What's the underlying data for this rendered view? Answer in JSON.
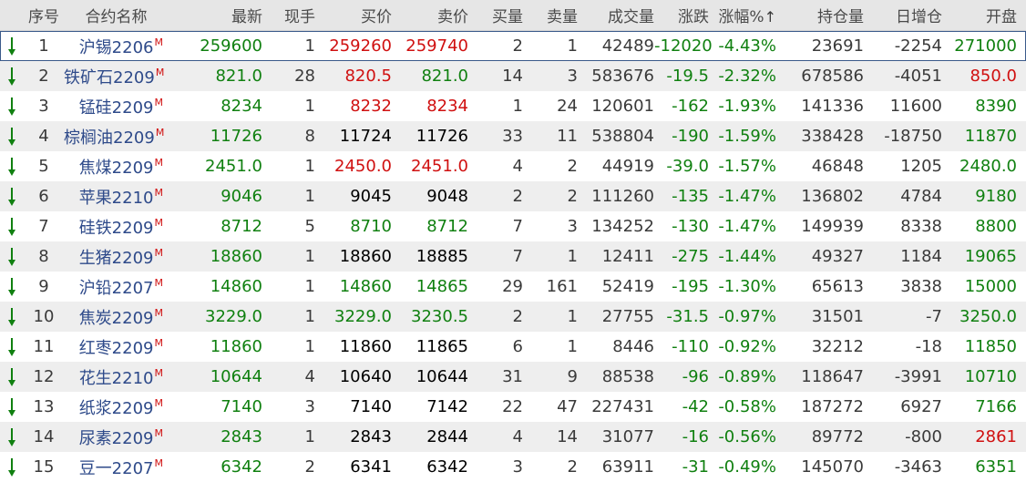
{
  "colors": {
    "up": "#d01010",
    "down": "#108010",
    "neutral": "#000000",
    "text": "#3a3a3a",
    "name": "#2e4a8a",
    "header_bg": "#e6e6e6",
    "alt_bg": "#eeeeee"
  },
  "header": {
    "seq": "序号",
    "name": "合约名称",
    "latest": "最新",
    "hand": "现手",
    "bid": "买价",
    "ask": "卖价",
    "bid_vol": "买量",
    "ask_vol": "卖量",
    "volume": "成交量",
    "change": "涨跌",
    "pct": "涨幅%",
    "sort_icon": "↑",
    "oi": "持仓量",
    "oi_change": "日增仓",
    "open": "开盘"
  },
  "rows": [
    {
      "seq": "1",
      "name": "沪锡2206",
      "m": "M",
      "latest": "259600",
      "latest_c": "down",
      "hand": "1",
      "bid": "259260",
      "bid_c": "up",
      "ask": "259740",
      "ask_c": "up",
      "bid_vol": "2",
      "ask_vol": "1",
      "volume": "42489",
      "change": "-12020",
      "pct": "-4.43%",
      "oi": "23691",
      "oi_change": "-2254",
      "open": "271000",
      "open_c": "down"
    },
    {
      "seq": "2",
      "name": "铁矿石2209",
      "m": "M",
      "latest": "821.0",
      "latest_c": "down",
      "hand": "28",
      "bid": "820.5",
      "bid_c": "up",
      "ask": "821.0",
      "ask_c": "down",
      "bid_vol": "14",
      "ask_vol": "3",
      "volume": "583676",
      "change": "-19.5",
      "pct": "-2.32%",
      "oi": "678586",
      "oi_change": "-4051",
      "open": "850.0",
      "open_c": "up"
    },
    {
      "seq": "3",
      "name": "锰硅2209",
      "m": "M",
      "latest": "8234",
      "latest_c": "down",
      "hand": "1",
      "bid": "8232",
      "bid_c": "up",
      "ask": "8234",
      "ask_c": "up",
      "bid_vol": "1",
      "ask_vol": "24",
      "volume": "120601",
      "change": "-162",
      "pct": "-1.93%",
      "oi": "141336",
      "oi_change": "11600",
      "open": "8390",
      "open_c": "down"
    },
    {
      "seq": "4",
      "name": "棕榈油2209",
      "m": "M",
      "latest": "11726",
      "latest_c": "down",
      "hand": "8",
      "bid": "11724",
      "bid_c": "neutral",
      "ask": "11726",
      "ask_c": "neutral",
      "bid_vol": "33",
      "ask_vol": "11",
      "volume": "538804",
      "change": "-190",
      "pct": "-1.59%",
      "oi": "338428",
      "oi_change": "-18750",
      "open": "11870",
      "open_c": "down"
    },
    {
      "seq": "5",
      "name": "焦煤2209",
      "m": "M",
      "latest": "2451.0",
      "latest_c": "down",
      "hand": "1",
      "bid": "2450.0",
      "bid_c": "up",
      "ask": "2451.0",
      "ask_c": "up",
      "bid_vol": "4",
      "ask_vol": "2",
      "volume": "44919",
      "change": "-39.0",
      "pct": "-1.57%",
      "oi": "46848",
      "oi_change": "1205",
      "open": "2480.0",
      "open_c": "down"
    },
    {
      "seq": "6",
      "name": "苹果2210",
      "m": "M",
      "latest": "9046",
      "latest_c": "down",
      "hand": "1",
      "bid": "9045",
      "bid_c": "neutral",
      "ask": "9048",
      "ask_c": "neutral",
      "bid_vol": "2",
      "ask_vol": "2",
      "volume": "111260",
      "change": "-135",
      "pct": "-1.47%",
      "oi": "136802",
      "oi_change": "4784",
      "open": "9180",
      "open_c": "down"
    },
    {
      "seq": "7",
      "name": "硅铁2209",
      "m": "M",
      "latest": "8712",
      "latest_c": "down",
      "hand": "5",
      "bid": "8710",
      "bid_c": "down",
      "ask": "8712",
      "ask_c": "down",
      "bid_vol": "7",
      "ask_vol": "3",
      "volume": "134252",
      "change": "-130",
      "pct": "-1.47%",
      "oi": "149939",
      "oi_change": "8338",
      "open": "8800",
      "open_c": "down"
    },
    {
      "seq": "8",
      "name": "生猪2209",
      "m": "M",
      "latest": "18860",
      "latest_c": "down",
      "hand": "1",
      "bid": "18860",
      "bid_c": "neutral",
      "ask": "18885",
      "ask_c": "neutral",
      "bid_vol": "7",
      "ask_vol": "1",
      "volume": "12411",
      "change": "-275",
      "pct": "-1.44%",
      "oi": "49327",
      "oi_change": "1184",
      "open": "19065",
      "open_c": "down"
    },
    {
      "seq": "9",
      "name": "沪铅2207",
      "m": "M",
      "latest": "14860",
      "latest_c": "down",
      "hand": "1",
      "bid": "14860",
      "bid_c": "down",
      "ask": "14865",
      "ask_c": "down",
      "bid_vol": "29",
      "ask_vol": "161",
      "volume": "52419",
      "change": "-195",
      "pct": "-1.30%",
      "oi": "65613",
      "oi_change": "3838",
      "open": "15000",
      "open_c": "down"
    },
    {
      "seq": "10",
      "name": "焦炭2209",
      "m": "M",
      "latest": "3229.0",
      "latest_c": "down",
      "hand": "1",
      "bid": "3229.0",
      "bid_c": "down",
      "ask": "3230.5",
      "ask_c": "down",
      "bid_vol": "2",
      "ask_vol": "1",
      "volume": "27755",
      "change": "-31.5",
      "pct": "-0.97%",
      "oi": "31501",
      "oi_change": "-7",
      "open": "3250.0",
      "open_c": "down"
    },
    {
      "seq": "11",
      "name": "红枣2209",
      "m": "M",
      "latest": "11860",
      "latest_c": "down",
      "hand": "1",
      "bid": "11860",
      "bid_c": "neutral",
      "ask": "11865",
      "ask_c": "neutral",
      "bid_vol": "6",
      "ask_vol": "1",
      "volume": "8446",
      "change": "-110",
      "pct": "-0.92%",
      "oi": "32212",
      "oi_change": "-18",
      "open": "11850",
      "open_c": "down"
    },
    {
      "seq": "12",
      "name": "花生2210",
      "m": "M",
      "latest": "10644",
      "latest_c": "down",
      "hand": "4",
      "bid": "10640",
      "bid_c": "neutral",
      "ask": "10644",
      "ask_c": "neutral",
      "bid_vol": "31",
      "ask_vol": "9",
      "volume": "88538",
      "change": "-96",
      "pct": "-0.89%",
      "oi": "118647",
      "oi_change": "-3991",
      "open": "10710",
      "open_c": "down"
    },
    {
      "seq": "13",
      "name": "纸浆2209",
      "m": "M",
      "latest": "7140",
      "latest_c": "down",
      "hand": "3",
      "bid": "7140",
      "bid_c": "neutral",
      "ask": "7142",
      "ask_c": "neutral",
      "bid_vol": "22",
      "ask_vol": "47",
      "volume": "227431",
      "change": "-42",
      "pct": "-0.58%",
      "oi": "187272",
      "oi_change": "6927",
      "open": "7166",
      "open_c": "down"
    },
    {
      "seq": "14",
      "name": "尿素2209",
      "m": "M",
      "latest": "2843",
      "latest_c": "down",
      "hand": "1",
      "bid": "2843",
      "bid_c": "neutral",
      "ask": "2844",
      "ask_c": "neutral",
      "bid_vol": "4",
      "ask_vol": "14",
      "volume": "31077",
      "change": "-16",
      "pct": "-0.56%",
      "oi": "89772",
      "oi_change": "-800",
      "open": "2861",
      "open_c": "up"
    },
    {
      "seq": "15",
      "name": "豆一2207",
      "m": "M",
      "latest": "6342",
      "latest_c": "down",
      "hand": "2",
      "bid": "6341",
      "bid_c": "neutral",
      "ask": "6342",
      "ask_c": "neutral",
      "bid_vol": "3",
      "ask_vol": "2",
      "volume": "63911",
      "change": "-31",
      "pct": "-0.49%",
      "oi": "145070",
      "oi_change": "-3463",
      "open": "6351",
      "open_c": "down"
    }
  ]
}
